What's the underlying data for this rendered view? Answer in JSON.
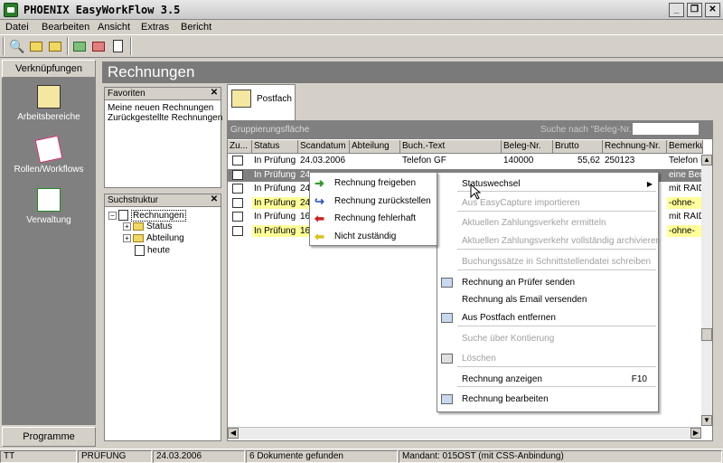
{
  "window": {
    "title": "PHOENIX EasyWorkFlow 3.5",
    "minimize_glyph": "_",
    "restore_glyph": "❐",
    "close_glyph": "✕"
  },
  "menu": [
    "Datei",
    "Bearbeiten",
    "Ansicht",
    "Extras",
    "Bericht"
  ],
  "toolbar": {
    "icons": [
      "search-icon",
      "folder-open-icon",
      "folder-edit-icon",
      "folder-green-icon",
      "folder-red-icon",
      "document-edit-icon"
    ]
  },
  "nav": {
    "header": "Verknüpfungen",
    "items": [
      {
        "label": "Arbeitsbereiche",
        "icon": "workspace-icon"
      },
      {
        "label": "Rollen/Workflows",
        "icon": "roles-icon"
      },
      {
        "label": "Verwaltung",
        "icon": "admin-icon"
      }
    ],
    "footer": "Programme"
  },
  "main": {
    "title": "Rechnungen"
  },
  "favorites": {
    "title": "Favoriten",
    "items": [
      "Meine neuen Rechnungen",
      "Zurückgestellte Rechnungen"
    ]
  },
  "search_tree": {
    "title": "Suchstruktur",
    "root": "Rechnungen",
    "children": [
      "Status",
      "Abteilung",
      "heute"
    ]
  },
  "tabs": [
    {
      "label": "Postfach",
      "icon": "inbox-icon"
    }
  ],
  "grid": {
    "group_label": "Gruppierungsfläche",
    "search_placeholder": "Suche nach \"Beleg-Nr.\"",
    "columns": [
      "Zu...",
      "Status",
      "Scandatum",
      "Abteilung",
      "Buch.-Text",
      "Beleg-Nr.",
      "Brutto",
      "Rechnung-Nr.",
      "Bemerkung"
    ],
    "rows": [
      {
        "status": "In Prüfung",
        "scandatum": "24.03.2006",
        "abteilung": "",
        "text": "Telefon GF",
        "beleg": "140000",
        "brutto": "55,62",
        "rechnung": "250123",
        "bemerkung": "Telefon F",
        "style": "normal"
      },
      {
        "status": "In Prüfung",
        "scandatum": "24.",
        "abteilung": "",
        "text": "",
        "beleg": "",
        "brutto": "",
        "rechnung": "",
        "bemerkung": "eine Bem",
        "style": "selected"
      },
      {
        "status": "In Prüfung",
        "scandatum": "24",
        "abteilung": "",
        "text": "",
        "beleg": "",
        "brutto": "",
        "rechnung": "",
        "bemerkung": "mit RAID",
        "style": "normal"
      },
      {
        "status": "In Prüfung",
        "scandatum": "24",
        "abteilung": "",
        "text": "",
        "beleg": "",
        "brutto": "",
        "rechnung": "",
        "bemerkung": "-ohne-",
        "style": "yellow"
      },
      {
        "status": "In Prüfung",
        "scandatum": "16",
        "abteilung": "",
        "text": "",
        "beleg": "",
        "brutto": "",
        "rechnung": "",
        "bemerkung": "mit RAID",
        "style": "normal"
      },
      {
        "status": "In Prüfung",
        "scandatum": "16",
        "abteilung": "",
        "text": "",
        "beleg": "",
        "brutto": "",
        "rechnung": "",
        "bemerkung": "-ohne-",
        "style": "yellow"
      }
    ]
  },
  "context_menu": {
    "items": [
      {
        "label": "Statuswechsel",
        "enabled": true,
        "submenu": true
      },
      {
        "label": "Aus EasyCapture importieren",
        "enabled": false
      },
      {
        "label": "Aktuellen Zahlungsverkehr ermitteln",
        "enabled": false
      },
      {
        "label": "Aktuellen Zahlungsverkehr vollständig archivieren",
        "enabled": false
      },
      {
        "label": "Buchungssätze in Schnittstellendatei schreiben",
        "enabled": false
      },
      {
        "label": "Rechnung an Prüfer senden",
        "enabled": true,
        "icon": "send-to-reviewer-icon"
      },
      {
        "label": "Rechnung als Email versenden",
        "enabled": true
      },
      {
        "label": "Aus Postfach entfernen",
        "enabled": true,
        "icon": "remove-from-inbox-icon"
      },
      {
        "label": "Suche über Kontierung",
        "enabled": false
      },
      {
        "label": "Löschen",
        "enabled": false,
        "icon": "delete-icon"
      },
      {
        "label": "Rechnung anzeigen",
        "enabled": true,
        "shortcut": "F10"
      },
      {
        "label": "Rechnung bearbeiten",
        "enabled": true,
        "icon": "edit-invoice-icon"
      }
    ]
  },
  "submenu": {
    "items": [
      {
        "label": "Rechnung freigeben",
        "icon": "arrow-right-green-icon",
        "color": "#2e9a2e"
      },
      {
        "label": "Rechnung zurückstellen",
        "icon": "arrow-return-blue-icon",
        "color": "#3355bb"
      },
      {
        "label": "Rechnung fehlerhaft",
        "icon": "arrow-left-red-icon",
        "color": "#cc2222"
      },
      {
        "label": "Nicht zuständig",
        "icon": "arrow-left-yellow-icon",
        "color": "#d8c020"
      }
    ]
  },
  "status": {
    "user": "TT",
    "state": "PRÜFUNG",
    "date": "24.03.2006",
    "documents": "6 Dokumente gefunden",
    "mandant": "Mandant: 015OST (mit CSS-Anbindung)"
  },
  "colors": {
    "selected_row": "#808080",
    "yellow_row": "#ffff99",
    "header_bar": "#7a7a7a"
  }
}
